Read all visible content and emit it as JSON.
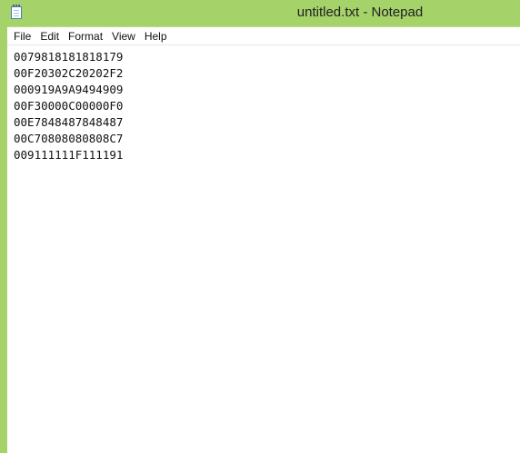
{
  "window": {
    "title": "untitled.txt - Notepad",
    "accent_color": "#a5d36a",
    "icon": "notepad-icon"
  },
  "menu": {
    "items": [
      {
        "label": "File"
      },
      {
        "label": "Edit"
      },
      {
        "label": "Format"
      },
      {
        "label": "View"
      },
      {
        "label": "Help"
      }
    ]
  },
  "editor": {
    "lines": [
      "0079818181818179",
      "00F20302C20202F2",
      "000919A9A9494909",
      "00F30000C00000F0",
      "00E7848487848487",
      "00C70808080808C7",
      "009111111F111191"
    ]
  }
}
